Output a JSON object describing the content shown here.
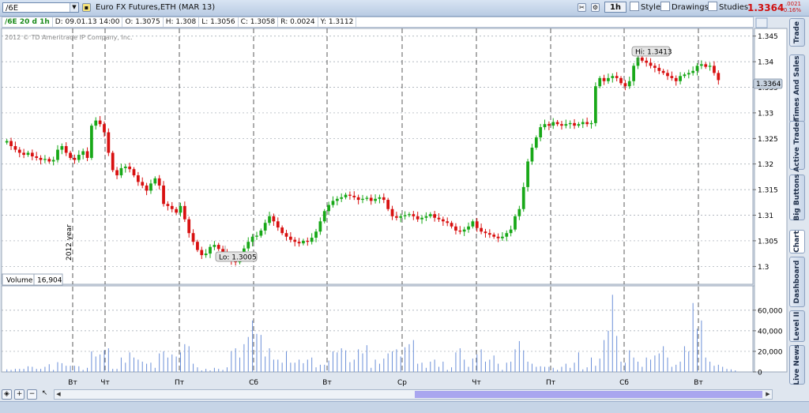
{
  "toolbar": {
    "symbol": "/6E",
    "title": "Euro FX Futures,ETH (MAR 13)",
    "timeframe": "1h",
    "style_label": "Style",
    "drawings_label": "Drawings",
    "studies_label": "Studies",
    "last_price": "1.3364",
    "change": ".0021",
    "change_pct": "-0.16%"
  },
  "infobar": {
    "symbol_period": "/6E 20 d 1h",
    "date": "D: 09.01.13 14:00",
    "open": "O: 1.3075",
    "high": "H: 1.308",
    "low": "L: 1.3056",
    "close": "C: 1.3058",
    "range": "R: 0.0024",
    "y": "Y: 1.3112"
  },
  "chart": {
    "copyright": "2012 © TD Ameritrade IP Company, Inc.",
    "year_label": "2012 year",
    "hi_label": "Hi: 1.3413",
    "lo_label": "Lo: 1.3005",
    "current_price_label": "1.3364",
    "volume_label": "Volume",
    "volume_value": "16,904"
  },
  "side_tabs": [
    "Trade",
    "Times And Sales",
    "Active Trader",
    "Big Buttons",
    "Chart",
    "Dashboard",
    "Level II",
    "Live News"
  ],
  "chart_data": [
    {
      "type": "candlestick",
      "ylim": [
        1.2965,
        1.3465
      ],
      "y_ticks": [
        "1.345",
        "1.34",
        "1.335",
        "1.33",
        "1.325",
        "1.32",
        "1.315",
        "1.31",
        "1.305",
        "1.3"
      ],
      "x_tick_labels": [
        "Вт",
        "Чт",
        "Пт",
        "Сб",
        "Вт",
        "Ср",
        "Чт",
        "Пт",
        "Сб",
        "Вт"
      ],
      "close": [
        1.3245,
        1.3235,
        1.3228,
        1.3222,
        1.3218,
        1.3222,
        1.3215,
        1.3212,
        1.3208,
        1.321,
        1.3205,
        1.3208,
        1.3228,
        1.3235,
        1.3222,
        1.3212,
        1.3208,
        1.3218,
        1.3225,
        1.3212,
        1.3275,
        1.3285,
        1.3278,
        1.3262,
        1.3222,
        1.3188,
        1.3178,
        1.3192,
        1.3195,
        1.319,
        1.3178,
        1.3165,
        1.3158,
        1.3148,
        1.3162,
        1.3172,
        1.3158,
        1.3122,
        1.3118,
        1.3112,
        1.3105,
        1.3118,
        1.3092,
        1.3065,
        1.3048,
        1.3032,
        1.3022,
        1.3025,
        1.3038,
        1.3042,
        1.3034,
        1.3025,
        1.3015,
        1.3012,
        1.3008,
        1.302,
        1.3035,
        1.3048,
        1.3058,
        1.306,
        1.307,
        1.3085,
        1.3098,
        1.3088,
        1.3076,
        1.3065,
        1.3058,
        1.3052,
        1.3048,
        1.3045,
        1.305,
        1.3048,
        1.3056,
        1.3068,
        1.3088,
        1.3108,
        1.312,
        1.3128,
        1.3132,
        1.3135,
        1.314,
        1.3138,
        1.3135,
        1.313,
        1.3132,
        1.3134,
        1.3128,
        1.3132,
        1.3135,
        1.313,
        1.3112,
        1.3098,
        1.3095,
        1.3098,
        1.31,
        1.3102,
        1.3098,
        1.3092,
        1.3095,
        1.3098,
        1.3102,
        1.3095,
        1.3092,
        1.3088,
        1.3085,
        1.3078,
        1.307,
        1.3068,
        1.3072,
        1.3078,
        1.3088,
        1.3075,
        1.3068,
        1.3065,
        1.3062,
        1.3058,
        1.3055,
        1.3058,
        1.3065,
        1.3072,
        1.3098,
        1.3112,
        1.3155,
        1.3205,
        1.3232,
        1.3252,
        1.3272,
        1.3278,
        1.3275,
        1.3282,
        1.3278,
        1.3275,
        1.3278,
        1.328,
        1.3275,
        1.3278,
        1.3282,
        1.3278,
        1.328,
        1.3352,
        1.3368,
        1.3362,
        1.3368,
        1.3372,
        1.3368,
        1.3358,
        1.3352,
        1.3362,
        1.3392,
        1.3408,
        1.3402,
        1.3398,
        1.3392,
        1.3388,
        1.3382,
        1.3378,
        1.3372,
        1.3368,
        1.3362,
        1.3372,
        1.3375,
        1.3378,
        1.3382,
        1.3392,
        1.3395,
        1.339,
        1.3392,
        1.3378,
        1.3364
      ],
      "volume": [
        2500,
        2000,
        3000,
        3000,
        3000,
        5500,
        5000,
        3000,
        3000,
        5000,
        7500,
        2000,
        9500,
        8500,
        6000,
        6000,
        6000,
        5500,
        2000,
        4000,
        20000,
        15000,
        17000,
        21000,
        23000,
        3000,
        3000,
        14000,
        9000,
        19000,
        14000,
        12000,
        10000,
        8000,
        9000,
        4000,
        18000,
        20000,
        14000,
        17000,
        15000,
        19000,
        27000,
        25000,
        8000,
        4500,
        1500,
        3000,
        1500,
        4000,
        3000,
        2000,
        4500,
        20000,
        23000,
        14000,
        27000,
        34000,
        50000,
        37000,
        36000,
        15000,
        23000,
        12000,
        12000,
        9000,
        20000,
        9000,
        9000,
        12000,
        8500,
        12000,
        14000,
        4500,
        7000,
        7000,
        11000,
        20000,
        19000,
        23000,
        21000,
        9500,
        12000,
        22000,
        18000,
        26000,
        4000,
        12000,
        8000,
        13000,
        18000,
        20000,
        22000,
        15000,
        24000,
        27000,
        31000,
        8000,
        9000,
        4000,
        10000,
        12000,
        5000,
        10000,
        2000,
        4500,
        19000,
        23000,
        12000,
        5000,
        13000,
        17000,
        22000,
        10000,
        12000,
        16000,
        8000,
        2000,
        9000,
        10000,
        22000,
        30000,
        21000,
        10000,
        8000,
        5000,
        5500,
        5000,
        5000,
        4000,
        2000,
        5000,
        8000,
        4000,
        9000,
        19000,
        2500,
        4500,
        14000,
        6000,
        13000,
        31000,
        40000,
        75000,
        35000,
        10000,
        9000,
        21000,
        14000,
        10000,
        5000,
        14000,
        12000,
        16000,
        18000,
        25000,
        14000,
        5000,
        7000,
        10000,
        25000,
        20000,
        67000,
        42000,
        50000,
        14000,
        10000,
        6000,
        7000,
        5000,
        3000,
        2500,
        1500
      ],
      "volume_ticks": [
        "60,000",
        "40,000",
        "20,000",
        "0"
      ]
    }
  ]
}
